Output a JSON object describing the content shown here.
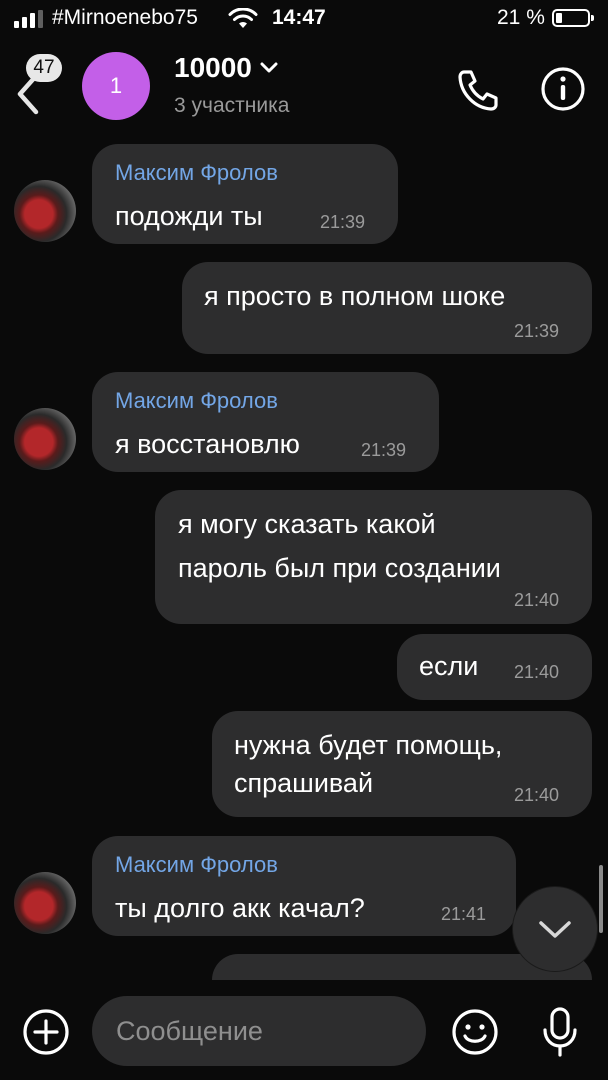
{
  "status_bar": {
    "carrier": "#Mirnoenebo75",
    "time": "14:47",
    "battery_percent": "21 %",
    "battery_level": 0.21,
    "signal_bars": 3
  },
  "header": {
    "unread_count": "47",
    "avatar_initial": "1",
    "avatar_color": "#c35fe8",
    "title": "10000",
    "subtitle": "3 участника"
  },
  "messages": [
    {
      "direction": "incoming",
      "author": "Максим Фролов",
      "lines": [
        "подожди ты"
      ],
      "time": "21:39"
    },
    {
      "direction": "outgoing",
      "lines": [
        "я просто в полном шоке"
      ],
      "time": "21:39"
    },
    {
      "direction": "incoming",
      "author": "Максим Фролов",
      "lines": [
        "я восстановлю"
      ],
      "time": "21:39"
    },
    {
      "direction": "outgoing",
      "lines": [
        "я могу сказать какой",
        "пароль был при создании"
      ],
      "time": "21:40"
    },
    {
      "direction": "outgoing",
      "lines": [
        "если"
      ],
      "time": "21:40"
    },
    {
      "direction": "outgoing",
      "lines": [
        "нужна будет помощь,",
        "спрашивай"
      ],
      "time": "21:40"
    },
    {
      "direction": "incoming",
      "author": "Максим Фролов",
      "lines": [
        "ты долго акк качал?"
      ],
      "time": "21:41"
    }
  ],
  "composer": {
    "placeholder": "Сообщение"
  },
  "colors": {
    "background": "#0a0a0a",
    "bubble": "#2d2d2e",
    "author_name": "#73a6e6",
    "timestamp": "#9b9b9b"
  }
}
